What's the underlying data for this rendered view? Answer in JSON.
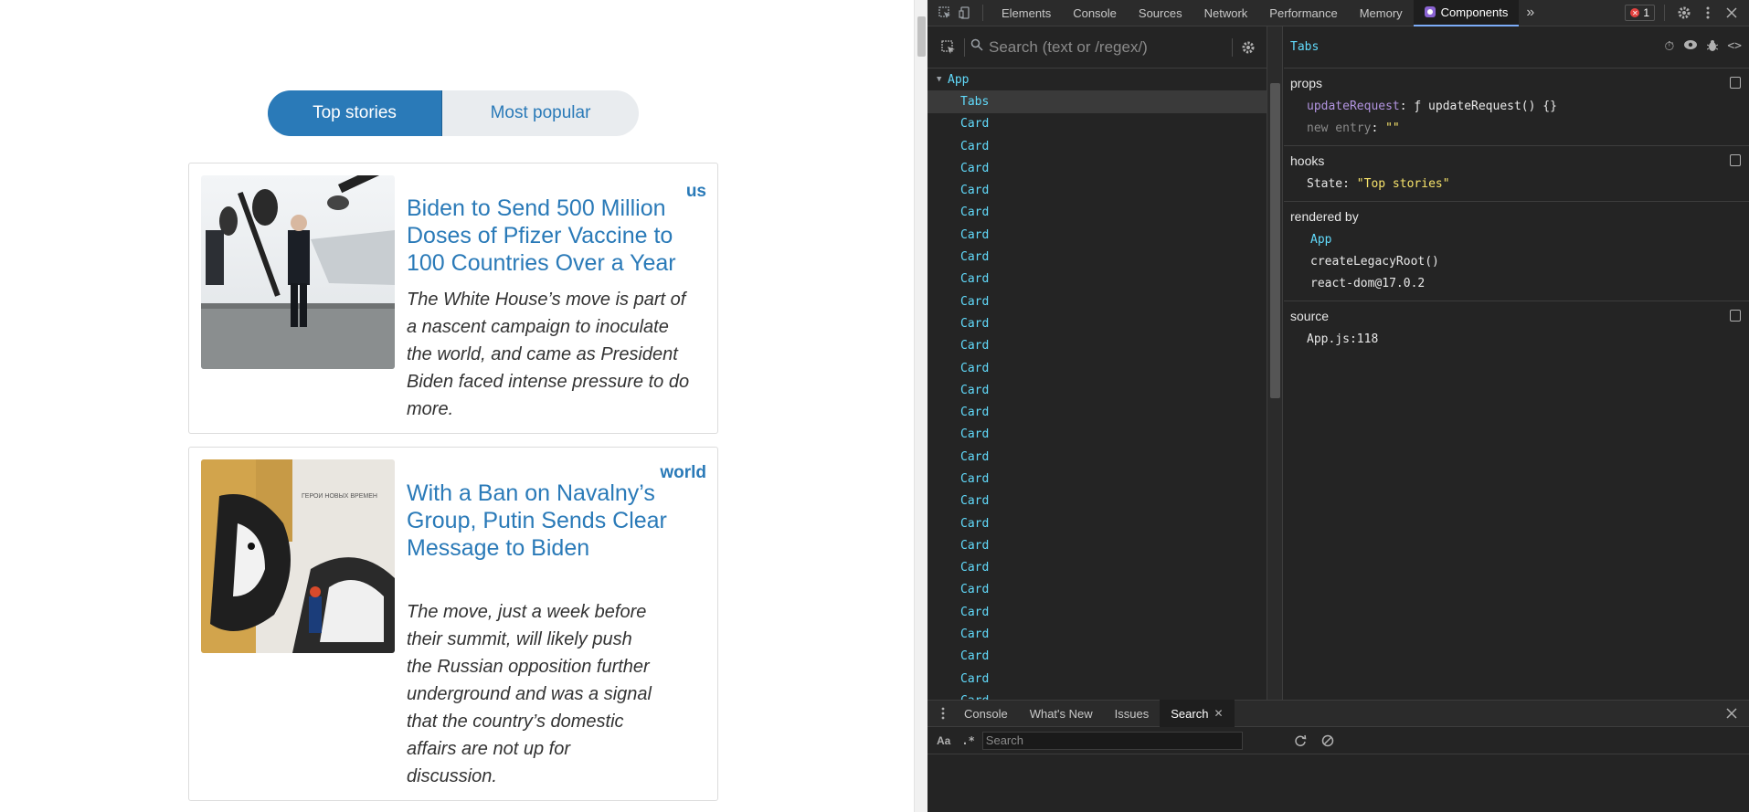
{
  "page": {
    "tabs": [
      {
        "label": "Top stories",
        "active": true
      },
      {
        "label": "Most popular",
        "active": false
      }
    ],
    "cards": [
      {
        "section": "us",
        "title": "Biden to Send 500 Million Doses of Pfizer Vaccine to 100 Countries Over a Year",
        "abstract": "The White House’s move is part of a nascent campaign to inoculate the world, and came as President Biden faced intense pressure to do more."
      },
      {
        "section": "world",
        "title": "With a Ban on Navalny’s Group, Putin Sends Clear Message to Biden",
        "abstract": "The move, just a week before their summit, will likely push the Russian opposition further underground and was a signal that the country’s domestic affairs are not up for discussion.",
        "image_text": "ГЕРОИ НОВЫХ ВРЕМЕН"
      }
    ]
  },
  "devtools": {
    "tabs": [
      "Elements",
      "Console",
      "Sources",
      "Network",
      "Performance",
      "Memory",
      "Components"
    ],
    "active_tab": "Components",
    "more_tabs": "»",
    "error_count": "1",
    "search_placeholder": "Search (text or /regex/)",
    "tree": {
      "root": "App",
      "selected": "Tabs",
      "card_label": "Card",
      "card_count": 27
    },
    "inspector": {
      "component": "Tabs",
      "props_title": "props",
      "props": [
        {
          "key": "updateRequest",
          "value": "ƒ updateRequest() {}"
        },
        {
          "key": "new entry",
          "value": "\"\""
        }
      ],
      "hooks_title": "hooks",
      "hooks": [
        {
          "key": "State:",
          "value": "\"Top stories\""
        }
      ],
      "rendered_by_title": "rendered by",
      "rendered_by": [
        "App",
        "createLegacyRoot()",
        "react-dom@17.0.2"
      ],
      "source_title": "source",
      "source": "App.js:118"
    },
    "drawer": {
      "tabs": [
        "Console",
        "What's New",
        "Issues",
        "Search"
      ],
      "active_tab": "Search",
      "case_label": "Aa",
      "regex_label": ".*",
      "search_placeholder": "Search"
    }
  }
}
